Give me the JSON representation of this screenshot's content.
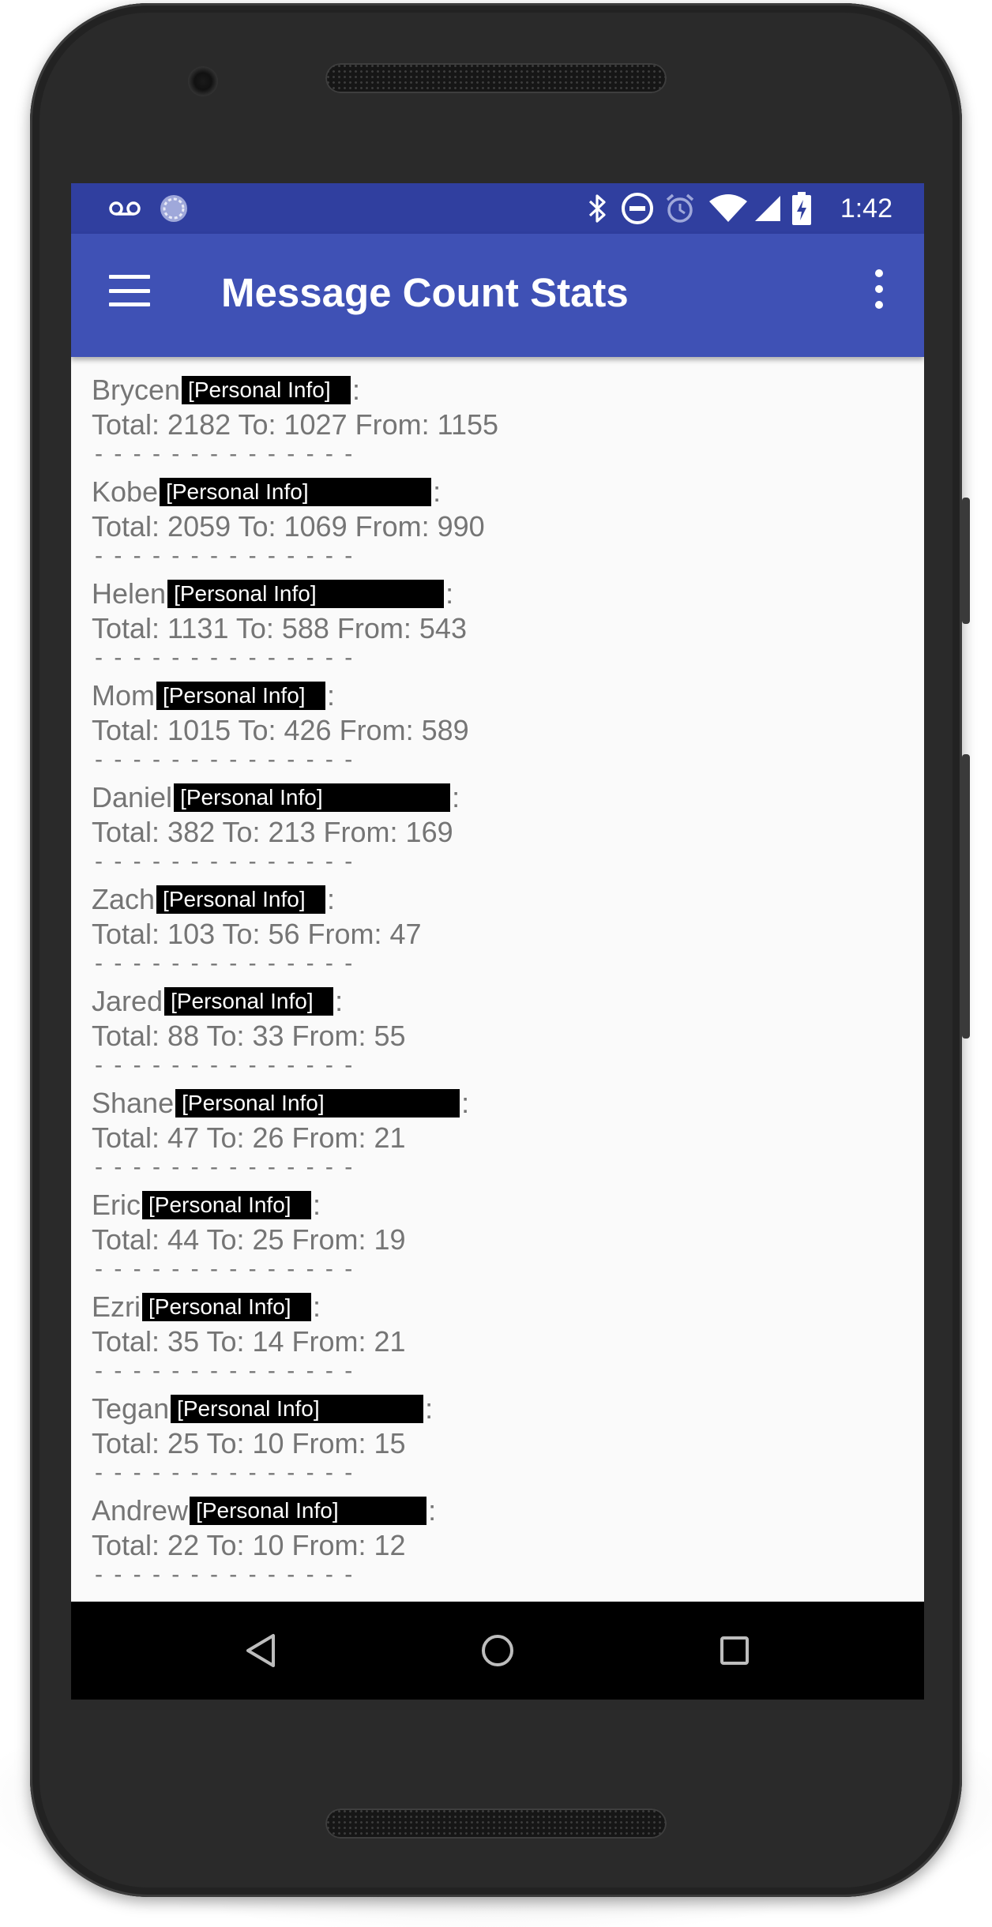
{
  "status_bar": {
    "time": "1:42",
    "left_icons": [
      "voicemail-icon",
      "sync-circle-icon"
    ],
    "right_icons": [
      "bluetooth-icon",
      "do-not-disturb-icon",
      "alarm-icon",
      "wifi-icon",
      "cell-signal-icon",
      "battery-charging-icon"
    ]
  },
  "app_bar": {
    "title": "Message Count Stats",
    "menu_icon": "hamburger-menu-icon",
    "overflow_icon": "more-vert-icon"
  },
  "redaction_label": "[Personal Info]",
  "contacts": [
    {
      "name": "Brycen",
      "total": "Total: 2182 To: 1027 From: 1155"
    },
    {
      "name": "Kobe",
      "total": "Total: 2059 To: 1069 From: 990"
    },
    {
      "name": "Helen",
      "total": "Total: 1131 To: 588 From: 543"
    },
    {
      "name": "Mom",
      "total": "Total: 1015 To: 426 From: 589"
    },
    {
      "name": "Daniel",
      "total": "Total: 382 To: 213 From: 169"
    },
    {
      "name": "Zach",
      "total": "Total: 103 To: 56 From: 47"
    },
    {
      "name": "Jared",
      "total": "Total: 88 To: 33 From: 55"
    },
    {
      "name": "Shane",
      "total": "Total: 47 To: 26 From: 21"
    },
    {
      "name": "Eric",
      "total": "Total: 44 To: 25 From: 19"
    },
    {
      "name": "Ezri",
      "total": "Total: 35 To: 14 From: 21"
    },
    {
      "name": "Tegan",
      "total": "Total: 25 To: 10 From: 15"
    },
    {
      "name": "Andrew",
      "total": "Total: 22 To: 10 From: 12"
    }
  ],
  "separator": "- - - - - - - - - - - - - -",
  "colon": ":",
  "nav_bar": {
    "back_icon": "back-triangle-icon",
    "home_icon": "home-circle-icon",
    "recents_icon": "recents-square-icon"
  },
  "colors": {
    "status_bar": "#303f9f",
    "app_bar": "#3f51b5",
    "text": "#757575",
    "background": "#fafafa"
  }
}
